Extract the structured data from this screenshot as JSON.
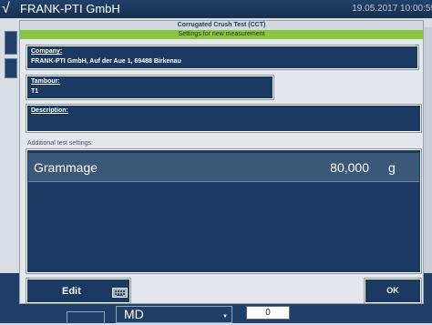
{
  "app": {
    "logo_glyph": "√",
    "title": "FRANK-PTI GmbH",
    "datetime": "19.05.2017 10:00:59"
  },
  "background": {
    "dropdown_value": "MD",
    "number_value": "0"
  },
  "dialog": {
    "title": "Corrugated Crush Test (CCT)",
    "subtitle": "Settings for new measurement",
    "fields": {
      "company": {
        "label": "Company:",
        "value": "FRANK-PTI GmbH, Auf der Aue 1, 69488 Birkenau"
      },
      "tambour": {
        "label": "Tambour:",
        "value": "T1"
      },
      "description": {
        "label": "Description:",
        "value": ""
      }
    },
    "additional_label": "Additional test settings:",
    "settings": [
      {
        "name": "Grammage",
        "value": "80,000",
        "unit": "g"
      }
    ],
    "edit_label": "Edit",
    "ok_label": "OK"
  },
  "colors": {
    "navy": "#1b3a63",
    "header_green": "#88c540",
    "dialog_bg": "#e4e8ec"
  }
}
